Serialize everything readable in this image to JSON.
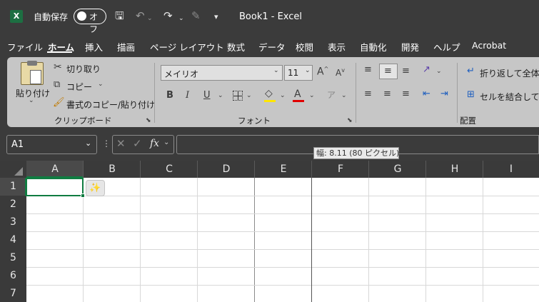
{
  "titlebar": {
    "logo": "X",
    "autosave_label": "自動保存",
    "autosave_state": "オフ",
    "title": "Book1  -  Excel",
    "icons": [
      "save-icon",
      "undo-icon",
      "redo-icon",
      "format-painter-icon",
      "customize-qat-icon"
    ]
  },
  "menu": [
    "ファイル",
    "ホーム",
    "挿入",
    "描画",
    "ページ レイアウト",
    "数式",
    "データ",
    "校閲",
    "表示",
    "自動化",
    "開発",
    "ヘルプ",
    "Acrobat"
  ],
  "menu_active": "ホーム",
  "ribbon": {
    "clipboard": {
      "paste": "貼り付け",
      "cut": "切り取り",
      "copy": "コピー",
      "format_painter": "書式のコピー/貼り付け",
      "label": "クリップボード"
    },
    "font": {
      "font_name": "メイリオ",
      "font_size": "11",
      "bold": "B",
      "italic": "I",
      "underline": "U",
      "font_color": "A",
      "label": "フォント"
    },
    "alignment": {
      "wrap_text": "折り返して全体を",
      "merge": "セルを結合して中",
      "label": "配置"
    }
  },
  "formula_bar": {
    "name_box": "A1",
    "fx": "fx",
    "value": ""
  },
  "tooltip": "幅: 8.11 (80 ピクセル)",
  "grid": {
    "columns": [
      "A",
      "B",
      "C",
      "D",
      "E",
      "F",
      "G",
      "H",
      "I"
    ],
    "rows": [
      "1",
      "2",
      "3",
      "4",
      "5",
      "6",
      "7"
    ],
    "selected_cell": "A1"
  },
  "colors": {
    "accent": "#107c41",
    "ribbon": "#c6c6c6",
    "chrome": "#3b3b3b"
  }
}
